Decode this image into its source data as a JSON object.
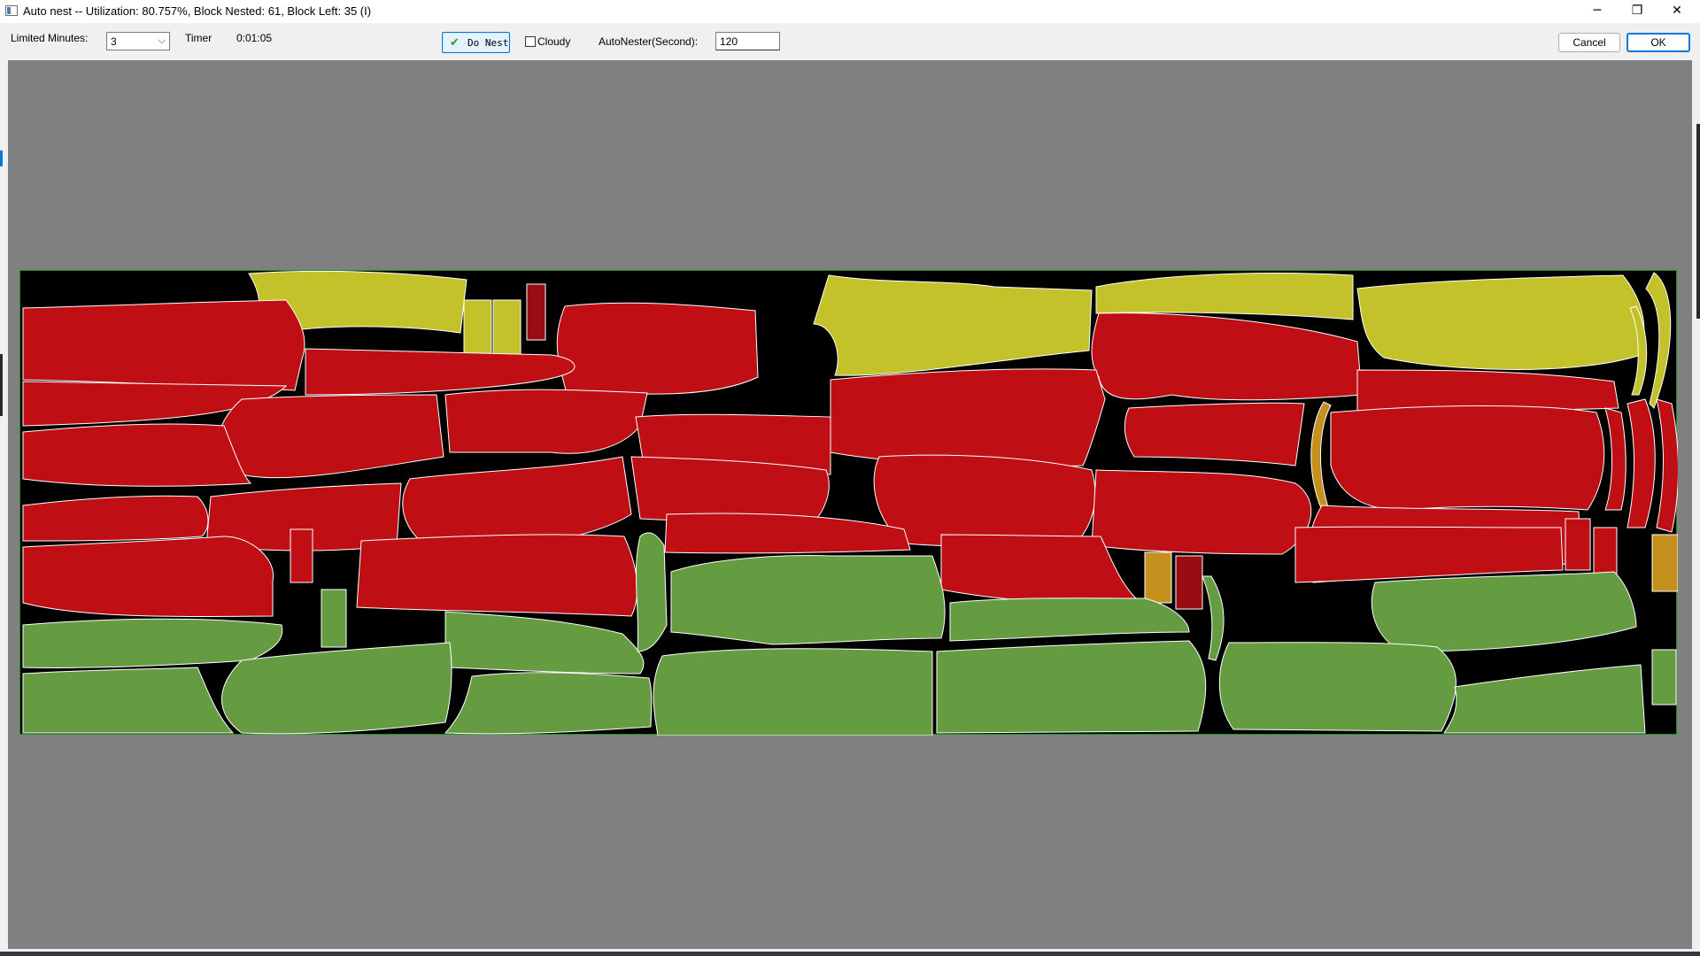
{
  "window": {
    "title": "Auto nest --  Utilization: 80.757%, Block Nested: 61, Block Left: 35   (I)",
    "icon": "app-icon",
    "controls": {
      "minimize": "─",
      "restore": "❐",
      "close": "✕"
    }
  },
  "toolbar": {
    "limited_minutes_label": "Limited Minutes:",
    "limited_minutes_value": "3",
    "timer_label": "Timer",
    "timer_value": "0:01:05",
    "do_nest_label": "Do Nest",
    "cloudy_label": "Cloudy",
    "cloudy_checked": false,
    "autonester_label": "AutoNester(Second):",
    "autonester_value": "120",
    "cancel_label": "Cancel",
    "ok_label": "OK"
  },
  "colors": {
    "canvas_bg": "#808080",
    "marker_bg": "#000000",
    "marker_border": "#1f8f1f",
    "piece_yellow": "#c4c22a",
    "piece_red": "#bf0f14",
    "piece_green": "#659c41",
    "piece_orange": "#c6901f",
    "piece_darkred": "#980c12",
    "piece_outline": "#ffffff"
  }
}
